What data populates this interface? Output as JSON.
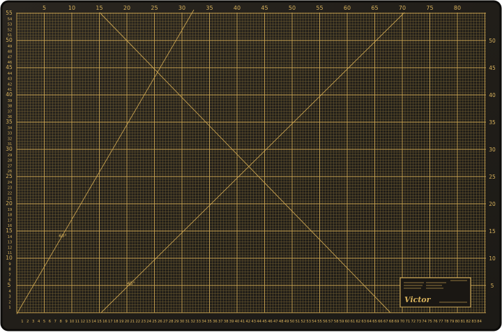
{
  "mat": {
    "colors": {
      "surface": "#221f1b",
      "grid_minor": "#7a6636",
      "grid_major": "#c9a351",
      "text": "#d8b25c",
      "edge": "#0d0c0a"
    },
    "top_ruler": [
      "5",
      "10",
      "15",
      "20",
      "25",
      "30",
      "35",
      "40",
      "45",
      "50",
      "55",
      "60",
      "65",
      "70",
      "75",
      "80"
    ],
    "bottom_ruler": [
      "1",
      "2",
      "3",
      "4",
      "5",
      "6",
      "7",
      "8",
      "9",
      "10",
      "11",
      "12",
      "13",
      "14",
      "15",
      "16",
      "17",
      "18",
      "19",
      "20",
      "21",
      "22",
      "23",
      "24",
      "25",
      "26",
      "27",
      "28",
      "29",
      "30",
      "31",
      "32",
      "33",
      "34",
      "35",
      "36",
      "37",
      "38",
      "39",
      "40",
      "41",
      "42",
      "43",
      "44",
      "45",
      "46",
      "47",
      "48",
      "49",
      "50",
      "51",
      "52",
      "53",
      "54",
      "55",
      "56",
      "57",
      "58",
      "59",
      "60",
      "61",
      "62",
      "63",
      "64",
      "65",
      "66",
      "67",
      "68",
      "69",
      "70",
      "71",
      "72",
      "73",
      "74",
      "75",
      "76",
      "77",
      "78",
      "79",
      "80",
      "81",
      "82",
      "83",
      "84"
    ],
    "left_ruler": [
      "1",
      "2",
      "3",
      "4",
      "5",
      "6",
      "7",
      "8",
      "9",
      "10",
      "11",
      "12",
      "13",
      "14",
      "15",
      "16",
      "17",
      "18",
      "19",
      "20",
      "21",
      "22",
      "23",
      "24",
      "25",
      "26",
      "27",
      "28",
      "29",
      "30",
      "31",
      "32",
      "33",
      "34",
      "35",
      "36",
      "37",
      "38",
      "39",
      "40",
      "41",
      "42",
      "43",
      "44",
      "45",
      "46",
      "47",
      "48",
      "49",
      "50",
      "51",
      "52",
      "53",
      "54",
      "55"
    ],
    "right_ruler": [
      "5",
      "10",
      "15",
      "20",
      "25",
      "30",
      "35",
      "40",
      "45",
      "50"
    ],
    "angle_labels": [
      "60°",
      "45°"
    ],
    "logo": {
      "brand": "Victor"
    }
  }
}
